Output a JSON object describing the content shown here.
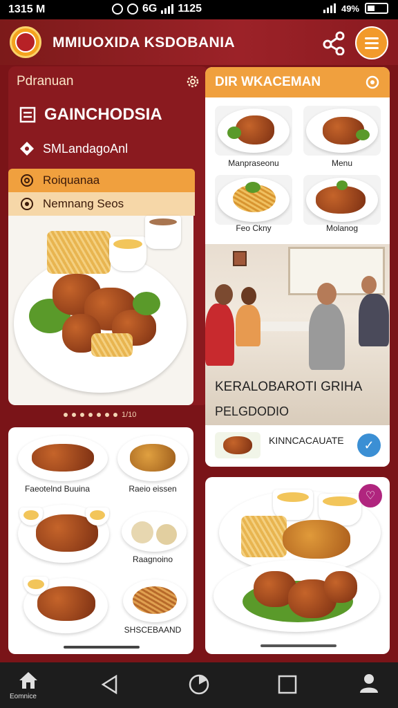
{
  "status_bar": {
    "time": "1315 M",
    "center_text": "6G",
    "right_time": "1125",
    "battery": "49%"
  },
  "header": {
    "title": "MMIUOXIDA KSDOBANIA",
    "logo_icon": "emblem-logo",
    "share_icon": "share-icon",
    "menu_icon": "hamburger-icon"
  },
  "nav_panel": {
    "heading": "Pdranuan",
    "settings_icon": "gear-icon",
    "items": [
      {
        "label": "GAINCHODSIA",
        "icon": "document-icon"
      },
      {
        "label": "SMLandagoAnl",
        "icon": "tag-icon"
      },
      {
        "label": "Roiquanaa",
        "icon": "search-icon"
      },
      {
        "label": "Nemnang Seos",
        "icon": "target-icon"
      }
    ],
    "carousel_text": "1/10"
  },
  "menu_card": {
    "heading": "DIR WKACEMAN",
    "search_icon": "search-icon",
    "thumbs": [
      {
        "label": "Manpraseonu"
      },
      {
        "label": "Menu"
      },
      {
        "label": "Feo Ckny"
      },
      {
        "label": "Molanog"
      }
    ],
    "photo_caption_1": "KERALOBAROTI GRIHA",
    "photo_caption_2": "PELGDODIO",
    "footer_label": "KINNCACAUATE",
    "check_icon": "check-icon"
  },
  "list_card": {
    "items": [
      {
        "label": "Faeotelnd Buuina"
      },
      {
        "label": "Raeio eissen"
      },
      {
        "label": ""
      },
      {
        "label": "Raagnoino"
      },
      {
        "label": ""
      },
      {
        "label": "SHSCEBAAND"
      }
    ]
  },
  "feature_card": {
    "fav_icon": "heart-icon"
  },
  "system_nav": {
    "home_label": "Eomnice"
  }
}
